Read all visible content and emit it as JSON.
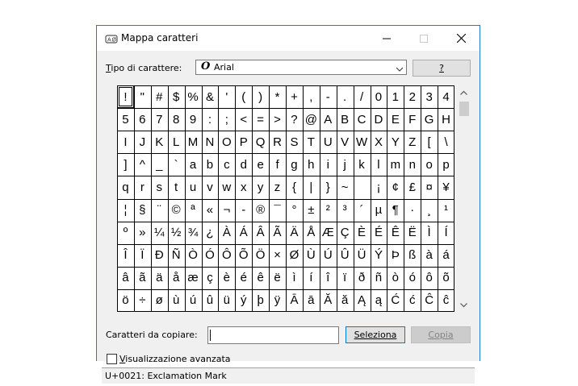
{
  "window": {
    "title": "Mappa caratteri"
  },
  "font_row": {
    "label": "Tipo di carattere:",
    "font_icon": "O",
    "selected_font": "Arial",
    "help_label": "?"
  },
  "char_grid": {
    "selected_index": 0,
    "rows": [
      [
        "!",
        "\"",
        "#",
        "$",
        "%",
        "&",
        "'",
        "(",
        ")",
        "*",
        "+",
        ",",
        "-",
        ".",
        "/",
        "0",
        "1",
        "2",
        "3",
        "4"
      ],
      [
        "5",
        "6",
        "7",
        "8",
        "9",
        ":",
        ";",
        "<",
        "=",
        ">",
        "?",
        "@",
        "A",
        "B",
        "C",
        "D",
        "E",
        "F",
        "G",
        "H"
      ],
      [
        "I",
        "J",
        "K",
        "L",
        "M",
        "N",
        "O",
        "P",
        "Q",
        "R",
        "S",
        "T",
        "U",
        "V",
        "W",
        "X",
        "Y",
        "Z",
        "[",
        "\\"
      ],
      [
        "]",
        "^",
        "_",
        "`",
        "a",
        "b",
        "c",
        "d",
        "e",
        "f",
        "g",
        "h",
        "i",
        "j",
        "k",
        "l",
        "m",
        "n",
        "o",
        "p"
      ],
      [
        "q",
        "r",
        "s",
        "t",
        "u",
        "v",
        "w",
        "x",
        "y",
        "z",
        "{",
        "|",
        "}",
        "~",
        " ",
        "¡",
        "¢",
        "£",
        "¤",
        "¥"
      ],
      [
        "¦",
        "§",
        "¨",
        "©",
        "ª",
        "«",
        "¬",
        "-",
        "®",
        "¯",
        "°",
        "±",
        "²",
        "³",
        "´",
        "µ",
        "¶",
        "·",
        "¸",
        "¹"
      ],
      [
        "º",
        "»",
        "¼",
        "½",
        "¾",
        "¿",
        "À",
        "Á",
        "Â",
        "Ã",
        "Ä",
        "Å",
        "Æ",
        "Ç",
        "È",
        "É",
        "Ê",
        "Ë",
        "Ì",
        "Í"
      ],
      [
        "Î",
        "Ï",
        "Ð",
        "Ñ",
        "Ò",
        "Ó",
        "Ô",
        "Õ",
        "Ö",
        "×",
        "Ø",
        "Ù",
        "Ú",
        "Û",
        "Ü",
        "Ý",
        "Þ",
        "ß",
        "à",
        "á"
      ],
      [
        "â",
        "ã",
        "ä",
        "å",
        "æ",
        "ç",
        "è",
        "é",
        "ê",
        "ë",
        "ì",
        "í",
        "î",
        "ï",
        "ð",
        "ñ",
        "ò",
        "ó",
        "ô",
        "õ"
      ],
      [
        "ö",
        "÷",
        "ø",
        "ù",
        "ú",
        "û",
        "ü",
        "ý",
        "þ",
        "ÿ",
        "Ā",
        "ā",
        "Ă",
        "ă",
        "Ą",
        "ą",
        "Ć",
        "ć",
        "Ĉ",
        "ĉ"
      ]
    ]
  },
  "copy_row": {
    "label": "Caratteri da copiare:",
    "value": "",
    "select_label": "Seleziona",
    "copy_label": "Copia"
  },
  "advanced": {
    "label": "Visualizzazione avanzata",
    "checked": false
  },
  "status": {
    "text": "U+0021: Exclamation Mark"
  },
  "colors": {
    "accent": "#0078d7",
    "window_border": "#1a7ad8",
    "client_bg": "#f0f0f0"
  }
}
